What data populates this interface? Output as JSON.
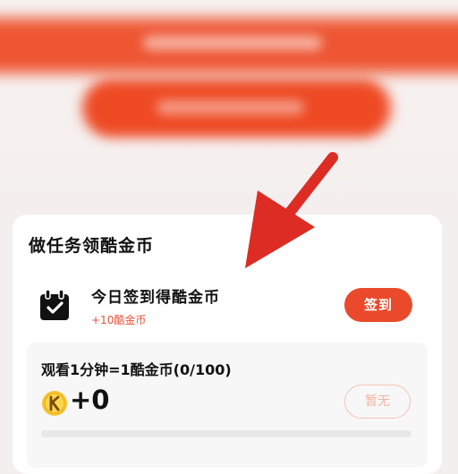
{
  "card": {
    "title": "做任务领酷金币"
  },
  "daily_task": {
    "title": "今日签到得酷金币",
    "reward": "+10酷金币",
    "button_label": "签到",
    "icon": "calendar-check-icon"
  },
  "watch_task": {
    "title": "观看1分钟=1酷金币(0/100)",
    "coin_icon": "kugou-coin-icon",
    "coin_value": "+0",
    "button_label": "暂无",
    "progress_current": 0,
    "progress_total": 100
  },
  "colors": {
    "accent": "#ea4a2b",
    "reward_text": "#e8503a",
    "disabled_border": "#f5c3b7",
    "disabled_text": "#f3b2a2",
    "annotation_arrow": "#dd2c24"
  }
}
